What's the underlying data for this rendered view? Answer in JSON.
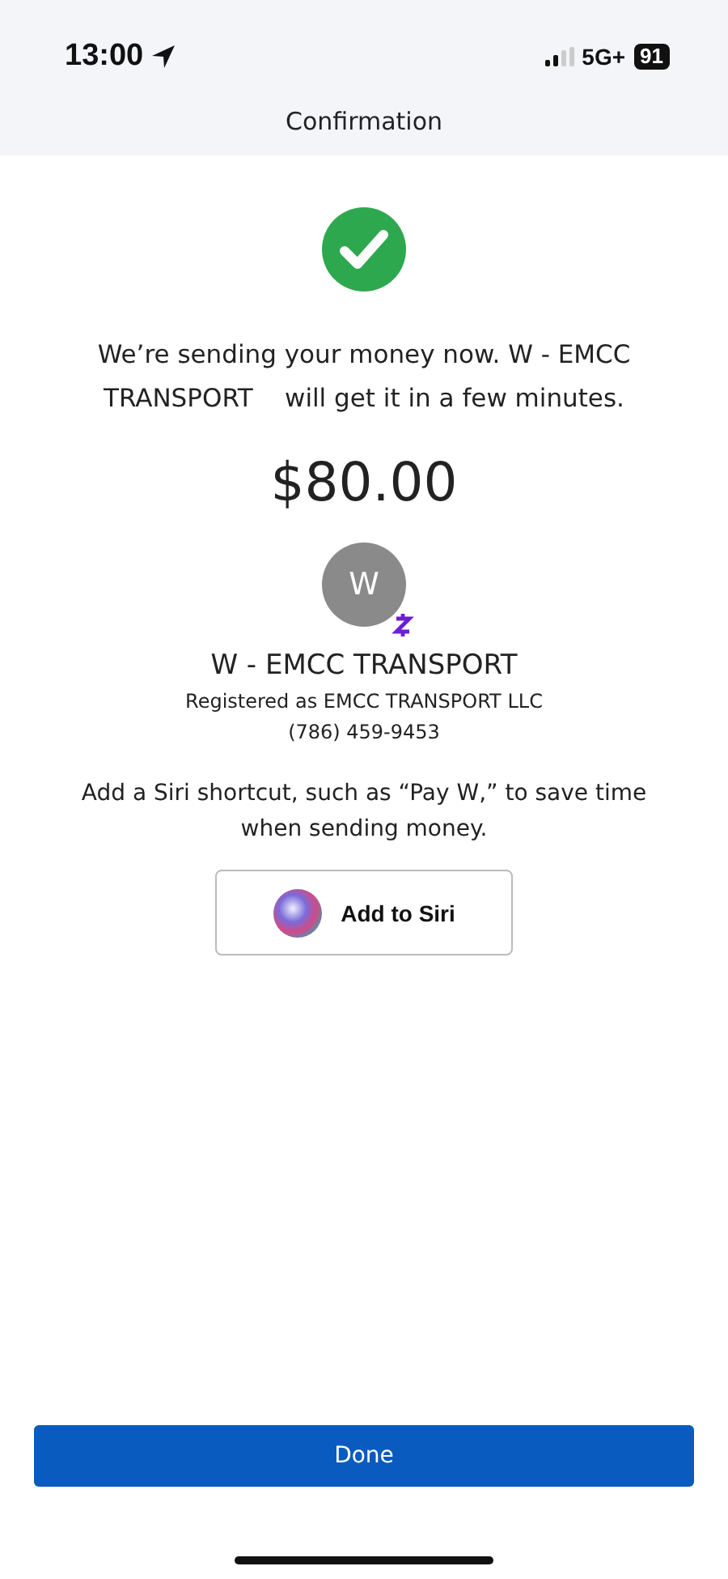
{
  "status_bar": {
    "time": "13:00",
    "network": "5G+",
    "battery": "91"
  },
  "header": {
    "title": "Confirmation"
  },
  "message": "We’re sending your money now. W - EMCC TRANSPORT    will get it in a few minutes.",
  "amount": "$80.00",
  "recipient": {
    "initial": "W",
    "name": "W - EMCC TRANSPORT",
    "registered": "Registered as EMCC TRANSPORT LLC",
    "phone": "(786) 459-9453"
  },
  "siri": {
    "text": "Add a Siri shortcut, such as “Pay W,” to save time when sending money.",
    "button": "Add to Siri"
  },
  "done_button": "Done"
}
